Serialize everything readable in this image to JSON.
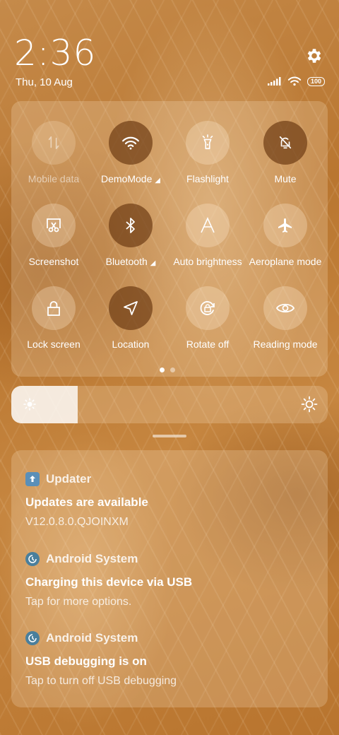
{
  "header": {
    "time": "2:36",
    "date": "Thu, 10 Aug",
    "battery": "100"
  },
  "quick_settings": {
    "tiles": [
      {
        "label": "Mobile data",
        "icon": "mobile-data-icon",
        "state": "disabled"
      },
      {
        "label": "DemoMode",
        "icon": "wifi-icon",
        "state": "on"
      },
      {
        "label": "Flashlight",
        "icon": "flashlight-icon",
        "state": "off"
      },
      {
        "label": "Mute",
        "icon": "bell-off-icon",
        "state": "on"
      },
      {
        "label": "Screenshot",
        "icon": "screenshot-icon",
        "state": "off"
      },
      {
        "label": "Bluetooth",
        "icon": "bluetooth-icon",
        "state": "on"
      },
      {
        "label": "Auto brightness",
        "icon": "auto-brightness-icon",
        "state": "off"
      },
      {
        "label": "Aeroplane mode",
        "icon": "airplane-icon",
        "state": "off"
      },
      {
        "label": "Lock screen",
        "icon": "lock-icon",
        "state": "off"
      },
      {
        "label": "Location",
        "icon": "location-icon",
        "state": "on"
      },
      {
        "label": "Rotate off",
        "icon": "rotate-lock-icon",
        "state": "off"
      },
      {
        "label": "Reading mode",
        "icon": "eye-icon",
        "state": "off"
      }
    ],
    "page_indicator": {
      "current": 1,
      "total": 2
    }
  },
  "brightness": {
    "level_fraction": 0.21
  },
  "notifications": [
    {
      "app": "Updater",
      "title": "Updates are available",
      "text": "V12.0.8.0.QJOINXM"
    },
    {
      "app": "Android System",
      "title": "Charging this device via USB",
      "text": "Tap for more options."
    },
    {
      "app": "Android System",
      "title": "USB debugging is on",
      "text": "Tap to turn off USB debugging"
    }
  ],
  "colors": {
    "active_tile": "#6e3c14",
    "wallpaper": "#b97630"
  }
}
